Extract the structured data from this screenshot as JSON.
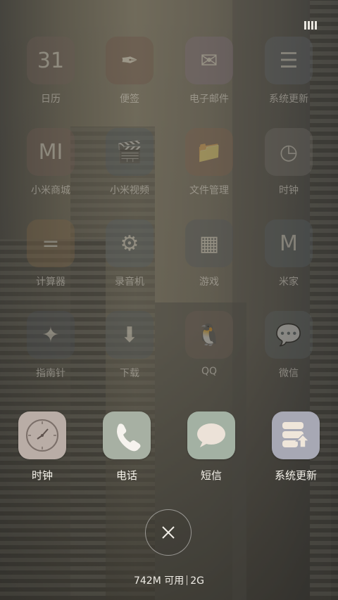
{
  "status_bar": {
    "battery_icon": "battery-icon"
  },
  "background_apps": [
    {
      "label": "日历",
      "glyph": "31",
      "color": "#6b5a55"
    },
    {
      "label": "便签",
      "glyph": "✒",
      "color": "#6a4f44"
    },
    {
      "label": "电子邮件",
      "glyph": "✉",
      "color": "#7a6a78"
    },
    {
      "label": "系统更新",
      "glyph": "☰",
      "color": "#5b6066"
    },
    {
      "label": "小米商城",
      "glyph": "MI",
      "color": "#6d5851"
    },
    {
      "label": "小米视频",
      "glyph": "🎬",
      "color": "#4e585e"
    },
    {
      "label": "文件管理",
      "glyph": "📁",
      "color": "#7a5c49"
    },
    {
      "label": "时钟",
      "glyph": "◷",
      "color": "#6f6b66"
    },
    {
      "label": "计算器",
      "glyph": "=",
      "color": "#7a6244"
    },
    {
      "label": "录音机",
      "glyph": "⚙",
      "color": "#545d63"
    },
    {
      "label": "游戏",
      "glyph": "▦",
      "color": "#4e5358"
    },
    {
      "label": "米家",
      "glyph": "M",
      "color": "#545d61"
    },
    {
      "label": "指南针",
      "glyph": "✦",
      "color": "#4a4f55"
    },
    {
      "label": "下载",
      "glyph": "⬇",
      "color": "#4e5559"
    },
    {
      "label": "QQ",
      "glyph": "🐧",
      "color": "#6a5b52"
    },
    {
      "label": "微信",
      "glyph": "💬",
      "color": "#565d5e"
    }
  ],
  "recent_apps": [
    {
      "label": "时钟",
      "icon": "clock-icon",
      "color": "#b9ada6"
    },
    {
      "label": "电话",
      "icon": "phone-icon",
      "color": "#a7b0a3"
    },
    {
      "label": "短信",
      "icon": "message-icon",
      "color": "#a3b1a3"
    },
    {
      "label": "系统更新",
      "icon": "system-update-icon",
      "color": "#a7a8b4"
    }
  ],
  "close_all": {
    "icon": "close-icon"
  },
  "memory": {
    "available": "742M 可用",
    "total": "2G"
  }
}
